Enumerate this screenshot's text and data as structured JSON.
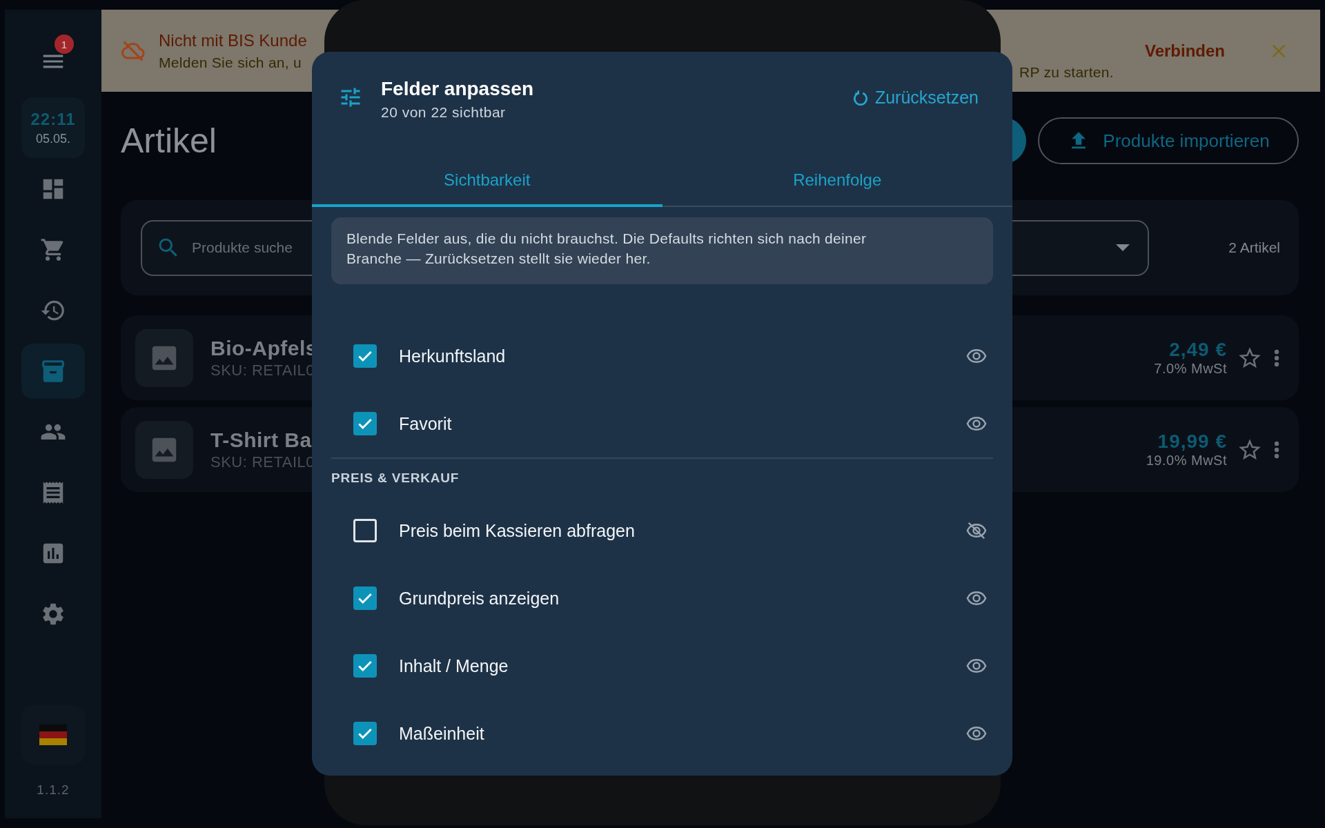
{
  "sidebar": {
    "menu_badge": "1",
    "clock": {
      "time": "22:11",
      "date": "05.05."
    },
    "nav_items": [
      {
        "kind": "dashboard",
        "selected": false
      },
      {
        "kind": "cart",
        "selected": false
      },
      {
        "kind": "history",
        "selected": false
      },
      {
        "kind": "archive",
        "selected": true
      },
      {
        "kind": "people",
        "selected": false
      },
      {
        "kind": "receipt",
        "selected": false
      },
      {
        "kind": "reports",
        "selected": false
      },
      {
        "kind": "settings",
        "selected": false
      }
    ],
    "version": "1.1.2"
  },
  "banner": {
    "title": "Nicht mit BIS Kunde",
    "message": "Melden Sie sich an, u",
    "message_end": "RP zu starten.",
    "action": "Verbinden"
  },
  "page": {
    "title": "Artikel",
    "import_button": "Produkte importieren",
    "search": {
      "placeholder": "Produkte suche"
    },
    "count": "2 Artikel"
  },
  "products": [
    {
      "name": "Bio-Apfels",
      "sku": "SKU: RETAIL0",
      "price": "2,49 €",
      "tax": "7.0% MwSt",
      "favorite": false
    },
    {
      "name": "T-Shirt Ba",
      "sku": "SKU: RETAIL0",
      "price": "19,99 €",
      "tax": "19.0% MwSt",
      "favorite": false
    }
  ],
  "dialog": {
    "title": "Felder anpassen",
    "subtitle": "20 von 22 sichtbar",
    "reset": "Zurücksetzen",
    "tabs": [
      {
        "label": "Sichtbarkeit",
        "selected": true
      },
      {
        "label": "Reihenfolge",
        "selected": false
      }
    ],
    "info": "Blende Felder aus, die du nicht brauchst. Die Defaults richten sich nach deiner Branche — Zurücksetzen stellt sie wieder her.",
    "groups": [
      {
        "fields": [
          {
            "label": "Herkunftsland",
            "checked": true
          },
          {
            "label": "Favorit",
            "checked": true
          }
        ]
      },
      {
        "heading": "PREIS & VERKAUF",
        "fields": [
          {
            "label": "Preis beim Kassieren abfragen",
            "checked": false
          },
          {
            "label": "Grundpreis anzeigen",
            "checked": true
          },
          {
            "label": "Inhalt / Menge",
            "checked": true
          },
          {
            "label": "Maßeinheit",
            "checked": true
          }
        ]
      }
    ]
  }
}
